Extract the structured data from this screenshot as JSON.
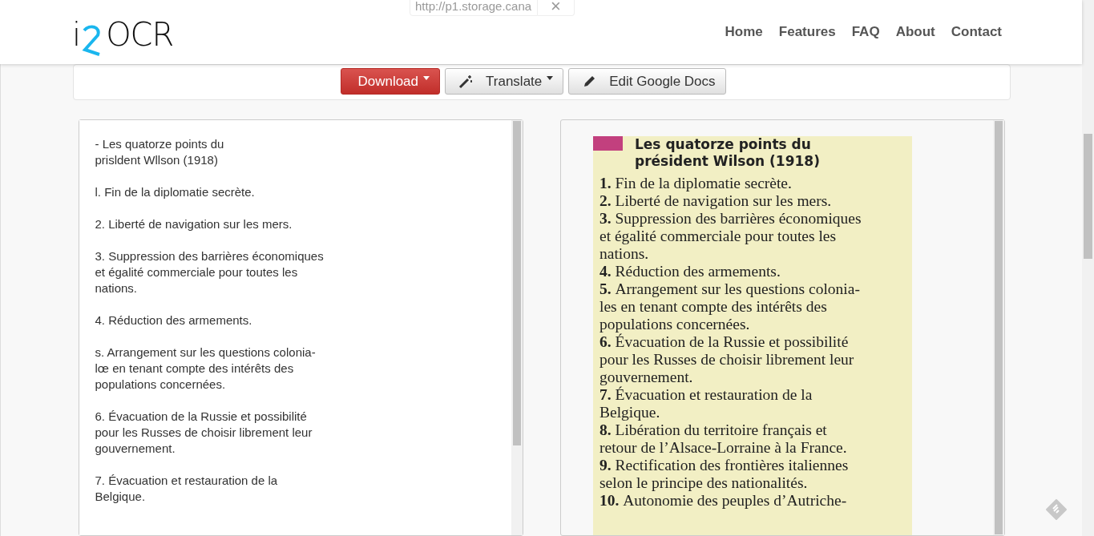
{
  "logo": {
    "text_i": "i",
    "text_ocr": "OCR"
  },
  "nav": [
    {
      "label": "Home"
    },
    {
      "label": "Features"
    },
    {
      "label": "FAQ"
    },
    {
      "label": "About"
    },
    {
      "label": "Contact"
    }
  ],
  "url_field": {
    "value": "http://p1.storage.cana",
    "clear": "×"
  },
  "buttons": [
    {
      "kind": "primary",
      "label": "Download",
      "dropdown": true
    },
    {
      "kind": "default",
      "label": "Translate",
      "dropdown": true
    },
    {
      "kind": "default",
      "label": "Edit Google Docs",
      "dropdown": false
    }
  ],
  "ocr_text": "- Les quatorze points du\nprisldent Wllson (1918)\n\nl. Fin de la diplomatie secrète.\n\n2. Liberté de navigation sur les mers.\n\n3. Suppression des barrières économiques\net égalité commerciale pour toutes les\nnations.\n\n4. Réduction des armements.\n\ns. Arrangement sur les questions colonia-\nlœ en tenant compte des intérêts des\npopulations concernées.\n\n6. Évacuation de la Russie et possibilité\npour les Russes de choisir librement leur\ngouvernement.\n\n7. Évacuation et restauration de la\nBelgique.",
  "document": {
    "title": [
      "Les quatorze points du",
      "président Wilson (1918)"
    ],
    "lines": [
      {
        "num": "1.",
        "text": "Fin de la diplomatie secrète."
      },
      {
        "num": "2.",
        "text": "Liberté de navigation sur les mers."
      },
      {
        "num": "3.",
        "text": "Suppression des barrières économiques"
      },
      {
        "text": "et égalité commerciale pour toutes les"
      },
      {
        "text": "nations."
      },
      {
        "num": "4.",
        "text": "Réduction des armements."
      },
      {
        "num": "5.",
        "text": "Arrangement sur les questions colonia-"
      },
      {
        "text": "les en tenant compte des intérêts des"
      },
      {
        "text": "populations concernées."
      },
      {
        "num": "6.",
        "text": "Évacuation de la Russie et possibilité"
      },
      {
        "text": "pour les Russes de choisir librement leur"
      },
      {
        "text": "gouvernement."
      },
      {
        "num": "7.",
        "text": "Évacuation et restauration de la"
      },
      {
        "text": "Belgique."
      },
      {
        "num": "8.",
        "text": "Libération du territoire français et"
      },
      {
        "text": "retour de l’Alsace-Lorraine à la France."
      },
      {
        "num": "9.",
        "text": "Rectification des frontières italiennes"
      },
      {
        "text": "selon le principe des nationalités."
      },
      {
        "num": "10.",
        "text": "Autonomie des peuples d’Autriche-"
      }
    ]
  }
}
